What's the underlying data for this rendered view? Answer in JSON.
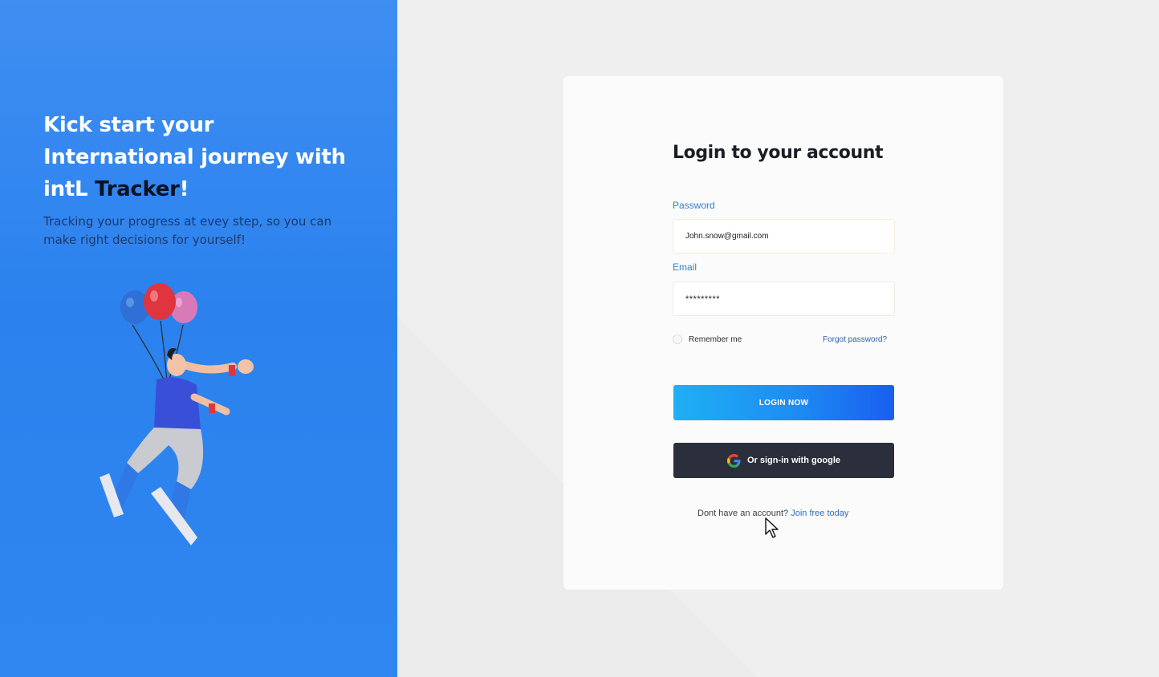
{
  "hero": {
    "title_line1": "Kick start your",
    "title_line2": "International journey with",
    "title_brand_prefix": "intL ",
    "title_brand_name": "Tracker",
    "title_brand_suffix": "!",
    "subtitle": "Tracking your progress at evey step, so you can make right decisions for yourself!"
  },
  "login": {
    "title": "Login to your account",
    "field1_label": "Password",
    "field1_value": "John.snow@gmail.com",
    "field2_label": "Email",
    "field2_value": "*********",
    "remember_label": "Remember me",
    "forgot_label": "Forgot password?",
    "login_button": "LOGIN NOW",
    "google_button": "Or sign-in with google",
    "signup_prompt": "Dont have an account?",
    "signup_link": "Join free today"
  },
  "icons": {
    "google": "google-icon",
    "cursor": "mouse-cursor-icon"
  },
  "colors": {
    "left_panel": "#2b82ee",
    "accent": "#2f7fd8",
    "login_button": "#1d8cf2",
    "google_button": "#2a2f3b"
  }
}
